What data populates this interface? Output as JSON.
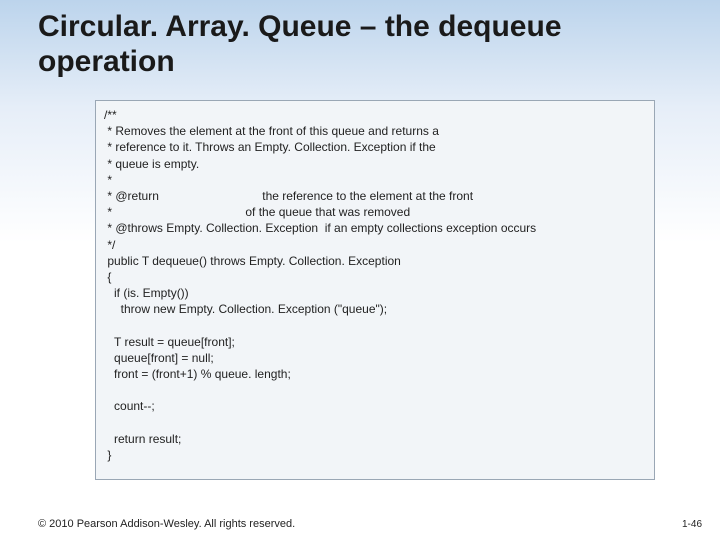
{
  "title_line1": "Circular. Array. Queue – the dequeue",
  "title_line2": "operation",
  "code": "/**\n * Removes the element at the front of this queue and returns a\n * reference to it. Throws an Empty. Collection. Exception if the\n * queue is empty.\n *\n * @return                               the reference to the element at the front\n *                                        of the queue that was removed\n * @throws Empty. Collection. Exception  if an empty collections exception occurs\n */\n public T dequeue() throws Empty. Collection. Exception\n {\n   if (is. Empty())\n     throw new Empty. Collection. Exception (\"queue\");\n\n   T result = queue[front];\n   queue[front] = null;\n   front = (front+1) % queue. length;\n\n   count--;\n\n   return result;\n }",
  "footer": "© 2010 Pearson Addison-Wesley. All rights reserved.",
  "pagenum": "1-46"
}
